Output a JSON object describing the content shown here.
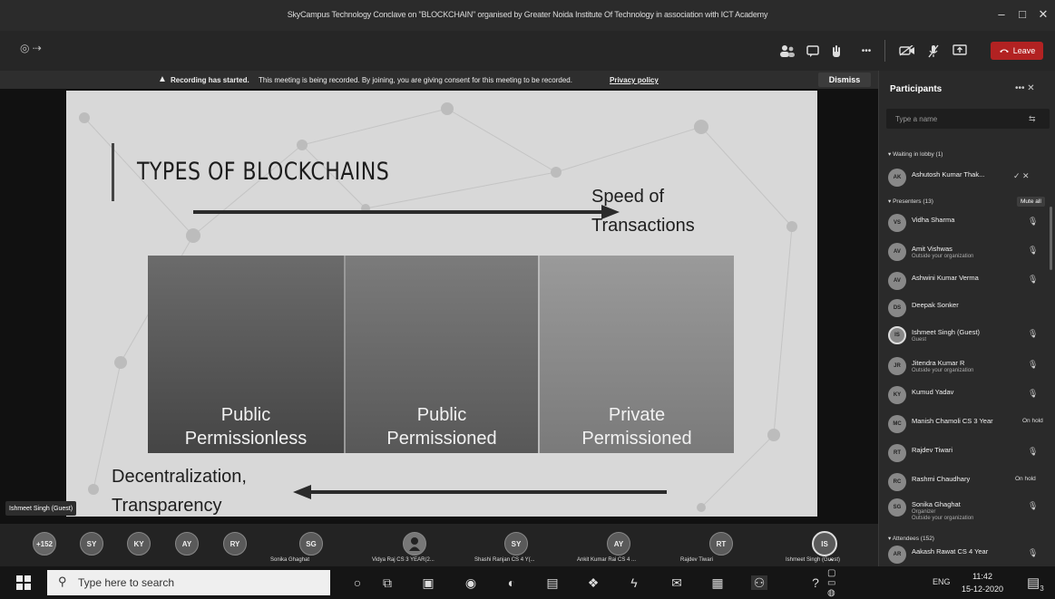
{
  "window": {
    "title": "SkyCampus Technology Conclave on \"BLOCKCHAIN\" organised by Greater Noida Institute Of Technology in association with ICT Academy",
    "minimize": "–",
    "maximize": "□",
    "close": "✕"
  },
  "toolbar": {
    "left_control": "◎ ⇢",
    "more_label": "•••",
    "leave_label": "Leave"
  },
  "banner": {
    "bold_text": "Recording has started.",
    "text": "This meeting is being recorded. By joining, you are giving consent for this meeting to be recorded.",
    "link": "Privacy policy",
    "dismiss_label": "Dismiss"
  },
  "slide": {
    "title": "TYPES OF BLOCKCHAINS",
    "speed_line1": "Speed of",
    "speed_line2": "Transactions",
    "box1_line1": "Public",
    "box1_line2": "Permissionless",
    "box2_line1": "Public",
    "box2_line2": "Permissioned",
    "box3_line1": "Private",
    "box3_line2": "Permissioned",
    "decen_line1": "Decentralization,",
    "decen_line2": "Transparency"
  },
  "presenter_tag": "Ishmeet Singh (Guest)",
  "strip": {
    "count": "+152",
    "avatars": [
      "SY",
      "KY",
      "AY",
      "RY",
      "SG",
      "SY",
      "AY",
      "RT",
      "IS"
    ],
    "names": [
      "Sonika Ghaghat",
      "Vidya Raj CS 3 YEAR(2...",
      "Shashi Ranjan CS 4 Y(...",
      "Ankit Kumar Rai CS 4 ...",
      "Rajdev Tiwari",
      "Ishmeet Singh (Guest)"
    ]
  },
  "panel": {
    "title": "Participants",
    "controls": "•••  ✕",
    "search_placeholder": "Type a name",
    "waiting_header": "Waiting in lobby (1)",
    "presenters_header": "Presenters (13)",
    "mute_all": "Mute all",
    "attendees_header": "Attendees (152)",
    "participants": [
      {
        "initials": "AK",
        "name": "Ashutosh Kumar Thak...",
        "sub": "",
        "sub2": "",
        "status": ""
      },
      {
        "initials": "VS",
        "name": "Vidha Sharma",
        "sub": "",
        "sub2": "",
        "status": ""
      },
      {
        "initials": "AV",
        "name": "Amit Vishwas",
        "sub": "Outside your organization",
        "sub2": "",
        "status": ""
      },
      {
        "initials": "AV",
        "name": "Ashwini Kumar Verma",
        "sub": "",
        "sub2": "",
        "status": ""
      },
      {
        "initials": "DS",
        "name": "Deepak Sonker",
        "sub": "",
        "sub2": "",
        "status": ""
      },
      {
        "initials": "IS",
        "name": "Ishmeet Singh (Guest)",
        "sub": "Guest",
        "sub2": "",
        "status": ""
      },
      {
        "initials": "JR",
        "name": "Jitendra Kumar R",
        "sub": "Outside your organization",
        "sub2": "",
        "status": ""
      },
      {
        "initials": "KY",
        "name": "Kumud Yadav",
        "sub": "",
        "sub2": "",
        "status": ""
      },
      {
        "initials": "MC",
        "name": "Manish Chamoli CS 3 Year",
        "sub": "",
        "sub2": "",
        "status": "On hold"
      },
      {
        "initials": "RT",
        "name": "Rajdev Tiwari",
        "sub": "",
        "sub2": "",
        "status": ""
      },
      {
        "initials": "RC",
        "name": "Rashmi Chaudhary",
        "sub": "",
        "sub2": "",
        "status": "On hold"
      },
      {
        "initials": "SG",
        "name": "Sonika Ghaghat",
        "sub": "Organizer",
        "sub2": "Outside your organization",
        "status": ""
      },
      {
        "initials": "AR",
        "name": "Aakash Rawat CS 4 Year",
        "sub": "",
        "sub2": "",
        "status": ""
      }
    ]
  },
  "taskbar": {
    "search_placeholder": "Type here to search",
    "language": "ENG",
    "time": "11:42",
    "date": "15-12-2020",
    "notification_count": "3"
  }
}
